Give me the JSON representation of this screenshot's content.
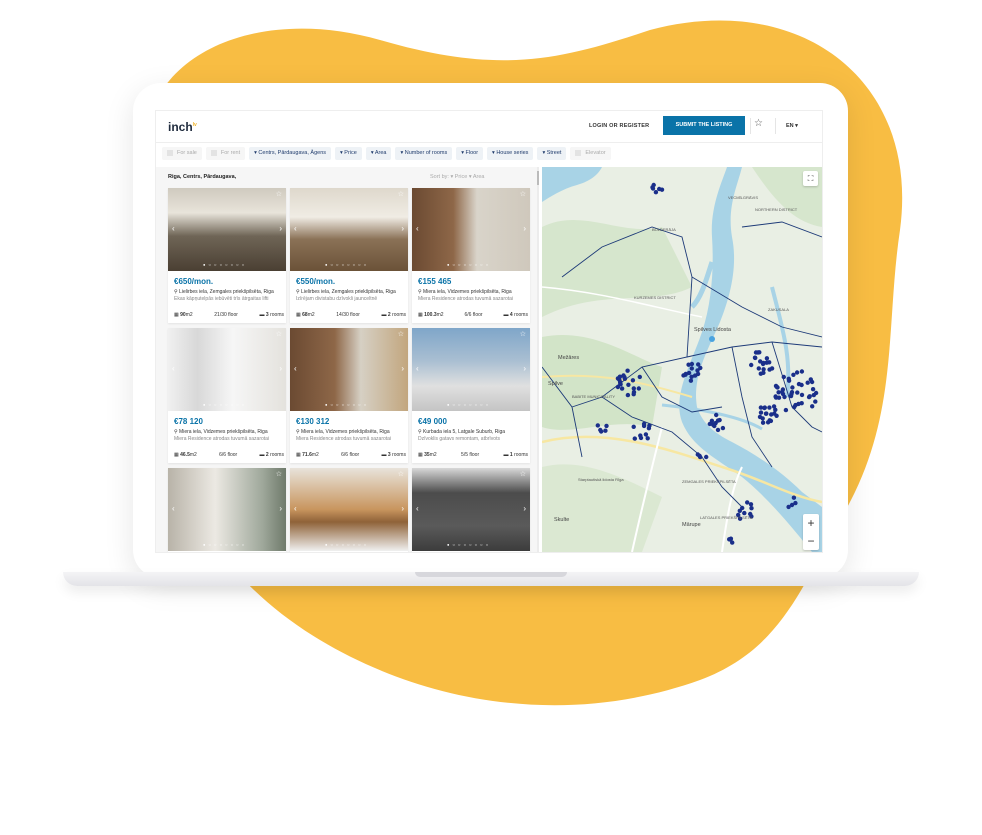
{
  "header": {
    "logo": "inch",
    "logo_sup": "lv",
    "login_label": "LOGIN OR REGISTER",
    "submit_label": "SUBMIT THE LISTING",
    "language": "EN ▾"
  },
  "filters": [
    {
      "label": "For sale",
      "muted": true
    },
    {
      "label": "For rent",
      "muted": true
    },
    {
      "label": "▾ Centrs, Pārdaugava, Āgens",
      "muted": false
    },
    {
      "label": "▾ Price",
      "muted": false
    },
    {
      "label": "▾ Area",
      "muted": false
    },
    {
      "label": "▾ Number of rooms",
      "muted": false
    },
    {
      "label": "▾ Floor",
      "muted": false
    },
    {
      "label": "▾ House series",
      "muted": false
    },
    {
      "label": "▾ Street",
      "muted": false
    },
    {
      "label": "Elevator",
      "muted": true
    }
  ],
  "list": {
    "location": "Riga, Centrs, Pārdaugava,",
    "sort_text": "Sort by:  ▾ Price   ▾ Area"
  },
  "listings": [
    {
      "price": "€650/mon.",
      "address": "⚲ Lielirbes iela, Zemgales priekšpilsēta, Riga",
      "desc": "Ēkas kāpņutelpās iebūvēti trīs ātrgaitas lifti",
      "area": "90",
      "floor": "21/30 floor",
      "rooms": "3"
    },
    {
      "price": "€550/mon.",
      "address": "⚲ Lielirbes iela, Zemgales priekšpilsēta, Riga",
      "desc": "Izīrējam divistabu dzīvokli jaunceltnē",
      "area": "68",
      "floor": "14/30 floor",
      "rooms": "2"
    },
    {
      "price": "€155 465",
      "address": "⚲ Miera iela, Vidzemes priekšpilsēta, Riga",
      "desc": "Miera Residence atrodas tuvumā sazarotai",
      "area": "100.3",
      "floor": "6/6 floor",
      "rooms": "4"
    },
    {
      "price": "€78 120",
      "address": "⚲ Miera iela, Vidzemes priekšpilsēta, Riga",
      "desc": "Miera Residence atrodas tuvumā sazarotai",
      "area": "46.5",
      "floor": "6/6 floor",
      "rooms": "2"
    },
    {
      "price": "€130 312",
      "address": "⚲ Miera iela, Vidzemes priekšpilsēta, Riga",
      "desc": "Miera Residence atrodas tuvumā sazarotai",
      "area": "71.6",
      "floor": "6/6 floor",
      "rooms": "3"
    },
    {
      "price": "€49 000",
      "address": "⚲ Kurbada iela 5, Latgale Suburb, Riga",
      "desc": "Dzīvoklis gatavs remontam, atbrīvots",
      "area": "35",
      "floor": "5/5 floor",
      "rooms": "1"
    },
    {
      "price": "",
      "address": "",
      "desc": "",
      "area": "",
      "floor": "",
      "rooms": ""
    },
    {
      "price": "",
      "address": "",
      "desc": "",
      "area": "",
      "floor": "",
      "rooms": ""
    },
    {
      "price": "",
      "address": "",
      "desc": "",
      "area": "",
      "floor": "",
      "rooms": ""
    }
  ],
  "units": {
    "area": "m2",
    "rooms": "rooms"
  },
  "map_labels": {
    "vecmilgravis": "VECMĪLGRĀVIS",
    "northern": "NORTHERN DISTRICT",
    "bolderaja": "BOLDERĀJA",
    "kurzemes": "KURZEMES DISTRICT",
    "zakusala": "ZAKUSALA",
    "spilves": "Spilves Lidosta",
    "mezares": "Mežāres",
    "spilve": "Spilve",
    "babite": "BABITE MUNICIPALITY",
    "starpt": "Starptautiskā lidosta Rīga",
    "skulte": "Skulte",
    "marupe": "Mārupe",
    "zemgales": "ZEMGALES PRIEKŠPILSĒTA",
    "latgales": "LATGALES PRIEKŠPILSĒTA"
  },
  "map_controls": {
    "fullscreen": "⛶",
    "zoom_in": "+",
    "zoom_out": "−"
  },
  "colors": {
    "accent": "#0a73a8",
    "blob": "#f8bd43",
    "marker": "#1a2f8a",
    "river": "#a8d3e6"
  }
}
